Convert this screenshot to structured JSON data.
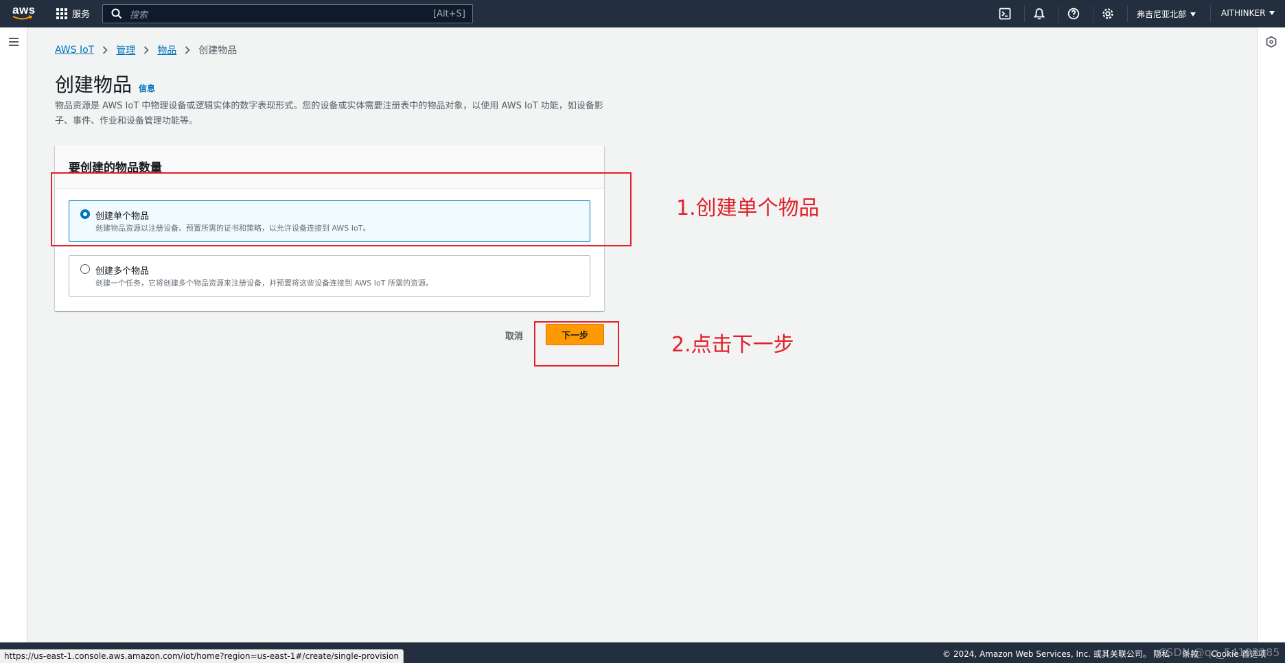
{
  "topnav": {
    "logo_text": "aws",
    "services_label": "服务",
    "search": {
      "placeholder": "搜索",
      "shortcut": "[Alt+S]"
    },
    "icons": [
      "cloudshell-icon",
      "bell-icon",
      "help-icon",
      "settings-icon"
    ],
    "region": "弗吉尼亚北部",
    "account": "AITHINKER"
  },
  "breadcrumb": {
    "items": [
      "AWS IoT",
      "管理",
      "物品"
    ],
    "current": "创建物品"
  },
  "page": {
    "title": "创建物品",
    "info_link": "信息",
    "description": "物品资源是 AWS IoT 中物理设备或逻辑实体的数字表现形式。您的设备或实体需要注册表中的物品对象，以使用 AWS IoT 功能，如设备影子、事件、作业和设备管理功能等。"
  },
  "panel": {
    "header": "要创建的物品数量",
    "options": [
      {
        "label": "创建单个物品",
        "description": "创建物品资源以注册设备。预置所需的证书和策略，以允许设备连接到 AWS IoT。",
        "selected": true
      },
      {
        "label": "创建多个物品",
        "description": "创建一个任务，它将创建多个物品资源来注册设备，并预置将这些设备连接到 AWS IoT 所需的资源。",
        "selected": false
      }
    ]
  },
  "actions": {
    "cancel": "取消",
    "next": "下一步"
  },
  "annotations": {
    "step1": "1.创建单个物品",
    "step2": "2.点击下一步",
    "color": "#e0202a"
  },
  "footer": {
    "copyright": "© 2024, Amazon Web Services, Inc. 或其关联公司。",
    "links": [
      "隐私",
      "条款",
      "Cookie 首选项"
    ],
    "watermark": "CSDN @qq_54193285"
  },
  "status_url": "https://us-east-1.console.aws.amazon.com/iot/home?region=us-east-1#/create/single-provision",
  "colors": {
    "nav_bg": "#232f3e",
    "link": "#0073bb",
    "primary_button": "#ff9900",
    "selected_tile_bg": "#f1faff"
  }
}
